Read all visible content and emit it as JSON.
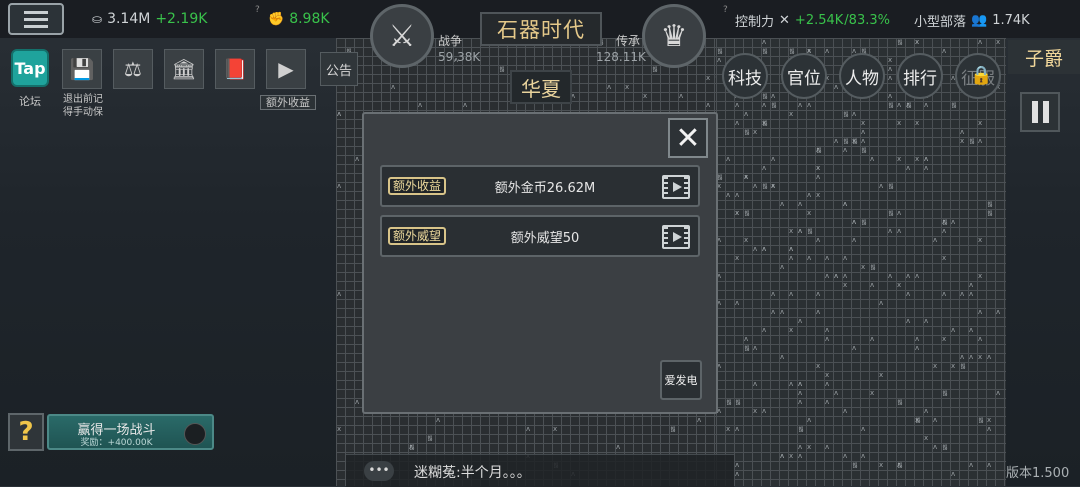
{
  "topbar": {
    "coins": "3.14M",
    "coins_delta": "+2.19K",
    "strength": "8.98K",
    "era_title": "石器时代",
    "war_label": "战争",
    "war_value": "59.38K",
    "legacy_label": "传承",
    "legacy_value": "128.11K",
    "control_label": "控制力",
    "control_delta": "+2.54K",
    "control_pct": "/83.3%",
    "tribe_label": "小型部落",
    "population": "1.74K"
  },
  "nation": "华夏",
  "toolbar": {
    "tap_label": "Tap",
    "forum_label": "论坛",
    "save_caption_1": "退出前记",
    "save_caption_2": "得手动保",
    "extra_income_label": "额外收益",
    "notice_label": "公告"
  },
  "right_menu": {
    "rank_title": "子爵",
    "tech": "科技",
    "office": "官位",
    "people": "人物",
    "ranking": "排行",
    "locked": "征服"
  },
  "dialog": {
    "rows": [
      {
        "tag": "额外收益",
        "text": "额外金币26.62M"
      },
      {
        "tag": "额外威望",
        "text": "额外威望50"
      }
    ],
    "aifadian_label": "爱发电"
  },
  "battle": {
    "title": "赢得一场战斗",
    "reward": "奖励：+400.00K"
  },
  "chat": {
    "text": "迷糊菟:半个月。。。"
  },
  "version": "版本1.500",
  "colors": {
    "accent_green": "#39c24b",
    "gold_text": "#e5c98a",
    "teal_button": "#1fa39c"
  }
}
